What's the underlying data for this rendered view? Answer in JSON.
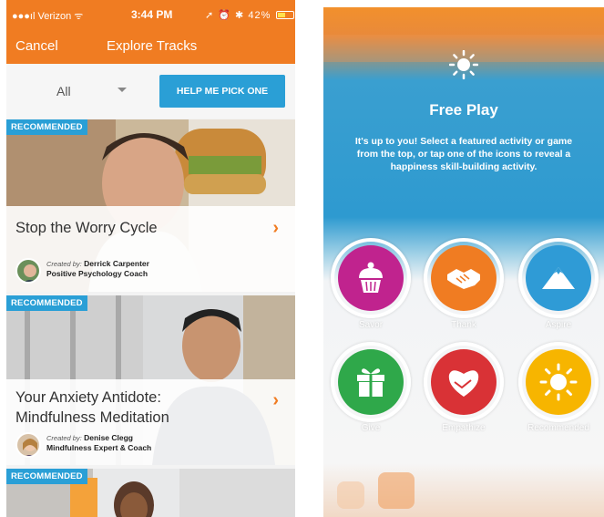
{
  "status": {
    "carrier": "Verizon",
    "time": "3:44 PM",
    "battery": "42%"
  },
  "nav": {
    "cancel": "Cancel",
    "title": "Explore Tracks"
  },
  "filter": {
    "selected": "All",
    "pick_button": "HELP ME PICK ONE"
  },
  "cards": [
    {
      "badge": "RECOMMENDED",
      "title_lines": [
        "Stop the Worry Cycle"
      ],
      "created_by": "Created by:",
      "author": "Derrick Carpenter",
      "role": "Positive Psychology Coach"
    },
    {
      "badge": "RECOMMENDED",
      "title_lines": [
        "Your Anxiety Antidote:",
        "Mindfulness Meditation"
      ],
      "created_by": "Created by:",
      "author": "Denise Clegg",
      "role": "Mindfulness Expert & Coach"
    },
    {
      "badge": "RECOMMENDED"
    }
  ],
  "free_play": {
    "title": "Free Play",
    "description": "It's up to you! Select a featured activity or game from the top, or tap one of the icons to reveal a happiness skill-building activity.",
    "activities": [
      {
        "label": "Savor",
        "color": "#c0238e",
        "icon": "cupcake-icon"
      },
      {
        "label": "Thank",
        "color": "#f07c22",
        "icon": "handshake-icon"
      },
      {
        "label": "Aspire",
        "color": "#2f9bd6",
        "icon": "mountain-icon"
      },
      {
        "label": "Give",
        "color": "#2fa84a",
        "icon": "gift-icon"
      },
      {
        "label": "Empathize",
        "color": "#d93236",
        "icon": "heart-hand-icon"
      },
      {
        "label": "Recommended",
        "color": "#f7b500",
        "icon": "sun-icon"
      }
    ]
  },
  "colors": {
    "brand_orange": "#f07c22",
    "accent_blue": "#2a9fd6"
  }
}
